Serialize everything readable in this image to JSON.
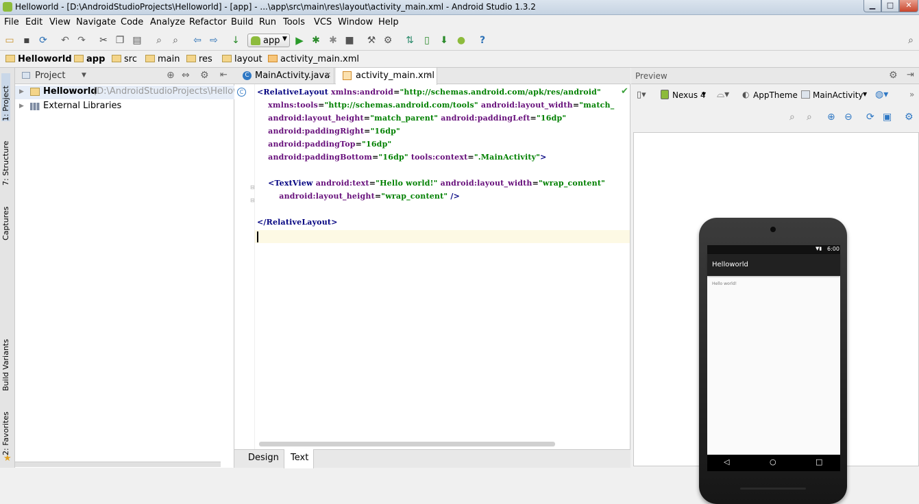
{
  "window": {
    "title": "Helloworld - [D:\\AndroidStudioProjects\\Helloworld] - [app] - ...\\app\\src\\main\\res\\layout\\activity_main.xml - Android Studio 1.3.2"
  },
  "menu": [
    "File",
    "Edit",
    "View",
    "Navigate",
    "Code",
    "Analyze",
    "Refactor",
    "Build",
    "Run",
    "Tools",
    "VCS",
    "Window",
    "Help"
  ],
  "toolbar": {
    "run_config": "app"
  },
  "breadcrumb": [
    "Helloworld",
    "app",
    "src",
    "main",
    "res",
    "layout",
    "activity_main.xml"
  ],
  "left_tabs": [
    "1: Project",
    "7: Structure",
    "Captures",
    "Build Variants",
    "2: Favorites"
  ],
  "project": {
    "header": "Project",
    "tree": [
      {
        "label": "Helloworld",
        "path": "(D:\\AndroidStudioProjects\\Helloworld)"
      },
      {
        "label": "External Libraries"
      }
    ]
  },
  "editor": {
    "tabs": [
      "MainActivity.java",
      "activity_main.xml"
    ],
    "lines": [
      [
        {
          "c": "tag",
          "t": "<RelativeLayout "
        },
        {
          "c": "attr",
          "t": "xmlns:android"
        },
        {
          "c": "t",
          "t": "="
        },
        {
          "c": "val",
          "t": "\"http://schemas.android.com/apk/res/android\""
        }
      ],
      [
        {
          "c": "attr",
          "t": "    xmlns:tools"
        },
        {
          "c": "t",
          "t": "="
        },
        {
          "c": "val",
          "t": "\"http://schemas.android.com/tools\""
        },
        {
          "c": "attr",
          "t": " android:layout_width"
        },
        {
          "c": "t",
          "t": "="
        },
        {
          "c": "val",
          "t": "\"match_"
        }
      ],
      [
        {
          "c": "attr",
          "t": "    android:layout_height"
        },
        {
          "c": "t",
          "t": "="
        },
        {
          "c": "val",
          "t": "\"match_parent\""
        },
        {
          "c": "attr",
          "t": " android:paddingLeft"
        },
        {
          "c": "t",
          "t": "="
        },
        {
          "c": "val",
          "t": "\"16dp\""
        }
      ],
      [
        {
          "c": "attr",
          "t": "    android:paddingRight"
        },
        {
          "c": "t",
          "t": "="
        },
        {
          "c": "val",
          "t": "\"16dp\""
        }
      ],
      [
        {
          "c": "attr",
          "t": "    android:paddingTop"
        },
        {
          "c": "t",
          "t": "="
        },
        {
          "c": "val",
          "t": "\"16dp\""
        }
      ],
      [
        {
          "c": "attr",
          "t": "    android:paddingBottom"
        },
        {
          "c": "t",
          "t": "="
        },
        {
          "c": "val",
          "t": "\"16dp\""
        },
        {
          "c": "attr",
          "t": " tools:context"
        },
        {
          "c": "t",
          "t": "="
        },
        {
          "c": "val",
          "t": "\".MainActivity\""
        },
        {
          "c": "tag",
          "t": ">"
        }
      ],
      [],
      [
        {
          "c": "tag",
          "t": "    <TextView "
        },
        {
          "c": "attr",
          "t": "android:text"
        },
        {
          "c": "t",
          "t": "="
        },
        {
          "c": "val",
          "t": "\"Hello world!\""
        },
        {
          "c": "attr",
          "t": " android:layout_width"
        },
        {
          "c": "t",
          "t": "="
        },
        {
          "c": "val",
          "t": "\"wrap_content\""
        }
      ],
      [
        {
          "c": "attr",
          "t": "        android:layout_height"
        },
        {
          "c": "t",
          "t": "="
        },
        {
          "c": "val",
          "t": "\"wrap_content\""
        },
        {
          "c": "tag",
          "t": " />"
        }
      ],
      [],
      [
        {
          "c": "tag",
          "t": "</RelativeLayout>"
        }
      ]
    ],
    "bottom_tabs": [
      "Design",
      "Text"
    ]
  },
  "preview": {
    "title": "Preview",
    "device": "Nexus 4",
    "theme": "AppTheme",
    "activity": "MainActivity",
    "phone": {
      "time": "6:00",
      "app_title": "Helloworld",
      "text": "Hello world!"
    }
  }
}
